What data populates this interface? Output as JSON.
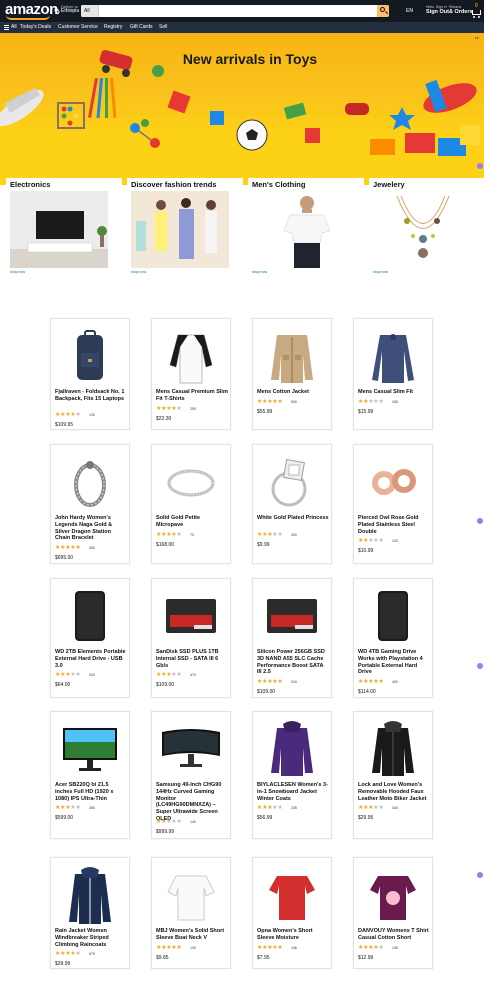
{
  "header": {
    "logo": "amazon",
    "deliver_line1": "Deliver to",
    "deliver_line2": "Ethiopia",
    "search_category": "All",
    "search_placeholder": "",
    "language": "EN",
    "account_line1": "Hello, Sign in",
    "account_line2": "Sign Out",
    "returns_line1": "Returns",
    "returns_line2": "& Orders",
    "cart_count": "0"
  },
  "subnav": {
    "all": "All",
    "items": [
      "Today's Deals",
      "Customer Service",
      "Registry",
      "Gift Cards",
      "Sell"
    ]
  },
  "hero": {
    "title": "New arrivals in Toys"
  },
  "categories": [
    {
      "title": "Electronics",
      "link": "shop now"
    },
    {
      "title": "Discover fashion trends",
      "link": "shop now"
    },
    {
      "title": "Men's Clothing",
      "link": "shop now"
    },
    {
      "title": "Jewelery",
      "link": "shop now"
    }
  ],
  "products": [
    {
      "title": "Fjallraven - Foldsack No. 1 Backpack, Fits 15 Laptops",
      "rating": 3.9,
      "count": "120",
      "price": "$109.95",
      "icon": "backpack-icon"
    },
    {
      "title": "Mens Casual Premium Slim Fit T-Shirts",
      "rating": 4.1,
      "count": "259",
      "price": "$22.30",
      "icon": "raglan-shirt-icon"
    },
    {
      "title": "Mens Cotton Jacket",
      "rating": 4.7,
      "count": "500",
      "price": "$55.99",
      "icon": "jacket-icon"
    },
    {
      "title": "Mens Casual Slim Fit",
      "rating": 2.1,
      "count": "430",
      "price": "$15.99",
      "icon": "longsleeve-icon"
    },
    {
      "title": "John Hardy Women's Legends Naga Gold & Silver Dragon Station Chain Bracelet",
      "rating": 4.6,
      "count": "400",
      "price": "$695.00",
      "icon": "bracelet-icon"
    },
    {
      "title": "Solid Gold Petite Micropave",
      "rating": 3.9,
      "count": "70",
      "price": "$168.00",
      "icon": "ring-icon"
    },
    {
      "title": "White Gold Plated Princess",
      "rating": 3.0,
      "count": "400",
      "price": "$9.99",
      "icon": "diamond-ring-icon"
    },
    {
      "title": "Pierced Owl Rose Gold Plated Stainless Steel Double",
      "rating": 1.9,
      "count": "100",
      "price": "$10.99",
      "icon": "earring-icon"
    },
    {
      "title": "WD 2TB Elements Portable External Hard Drive - USB 3.0",
      "rating": 3.3,
      "count": "203",
      "price": "$64.00",
      "icon": "hard-drive-icon"
    },
    {
      "title": "SanDisk SSD PLUS 1TB Internal SSD - SATA III 6 Gb/s",
      "rating": 2.9,
      "count": "470",
      "price": "$109.00",
      "icon": "ssd-icon"
    },
    {
      "title": "Silicon Power 256GB SSD 3D NAND A55 SLC Cache Performance Boost SATA III 2.5",
      "rating": 4.8,
      "count": "319",
      "price": "$109.00",
      "icon": "ssd-icon"
    },
    {
      "title": "WD 4TB Gaming Drive Works with Playstation 4 Portable External Hard Drive",
      "rating": 4.8,
      "count": "400",
      "price": "$114.00",
      "icon": "hard-drive-icon"
    },
    {
      "title": "Acer SB220Q bi 21.5 inches Full HD (1920 x 1080) IPS Ultra-Thin",
      "rating": 2.9,
      "count": "250",
      "price": "$599.00",
      "icon": "monitor-icon"
    },
    {
      "title": "Samsung 49-Inch CHG90 144Hz Curved Gaming Monitor (LC49HG90DMNXZA) – Super Ultrawide Screen QLED",
      "rating": 2.2,
      "count": "140",
      "price": "$999.99",
      "icon": "curved-monitor-icon"
    },
    {
      "title": "BIYLACLESEN Women's 3-in-1 Snowboard Jacket Winter Coats",
      "rating": 2.6,
      "count": "235",
      "price": "$56.99",
      "icon": "womens-jacket-icon"
    },
    {
      "title": "Lock and Love Women's Removable Hooded Faux Leather Moto Biker Jacket",
      "rating": 2.9,
      "count": "340",
      "price": "$29.95",
      "icon": "leather-jacket-icon"
    },
    {
      "title": "Rain Jacket Women Windbreaker Striped Climbing Raincoats",
      "rating": 3.8,
      "count": "679",
      "price": "$39.99",
      "icon": "raincoat-icon"
    },
    {
      "title": "MBJ Women's Solid Short Sleeve Boat Neck V",
      "rating": 4.7,
      "count": "130",
      "price": "$9.85",
      "icon": "white-top-icon"
    },
    {
      "title": "Opna Women's Short Sleeve Moisture",
      "rating": 4.5,
      "count": "146",
      "price": "$7.95",
      "icon": "red-tshirt-icon"
    },
    {
      "title": "DANVOUY Womens T Shirt Casual Cotton Short",
      "rating": 3.6,
      "count": "145",
      "price": "$12.99",
      "icon": "purple-tshirt-icon"
    }
  ],
  "colors": {
    "nav_dark": "#131921",
    "subnav": "#232f3e",
    "accent": "#febd69",
    "hero_yellow": "#fcd116",
    "star": "#f5a623",
    "link": "#007185"
  }
}
